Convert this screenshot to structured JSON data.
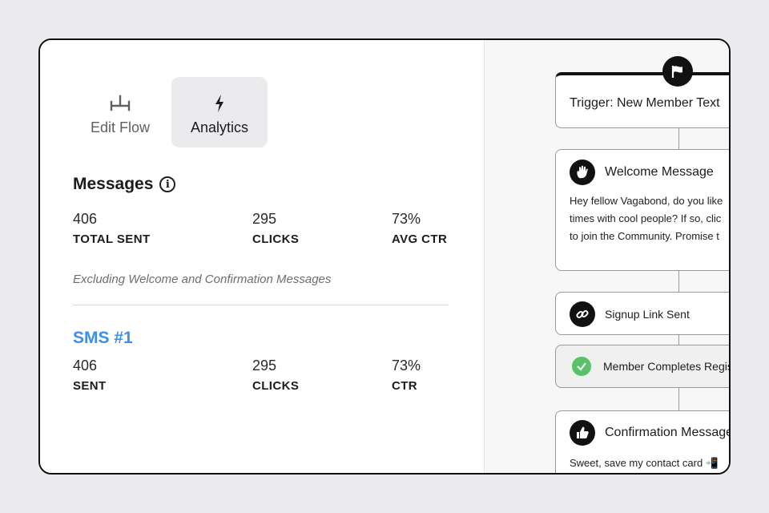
{
  "tabs": [
    {
      "label": "Edit Flow",
      "icon": "flow-icon"
    },
    {
      "label": "Analytics",
      "icon": "lightning-icon"
    }
  ],
  "messages": {
    "title": "Messages",
    "info_icon": "i",
    "stats": [
      {
        "value": "406",
        "label": "TOTAL SENT"
      },
      {
        "value": "295",
        "label": "CLICKS"
      },
      {
        "value": "73%",
        "label": "AVG CTR"
      }
    ],
    "note": "Excluding Welcome and Confirmation Messages"
  },
  "sms": {
    "title": "SMS #1",
    "stats": [
      {
        "value": "406",
        "label": "SENT"
      },
      {
        "value": "295",
        "label": "CLICKS"
      },
      {
        "value": "73%",
        "label": "CTR"
      }
    ]
  },
  "flow": {
    "trigger": "Trigger: New Member Text",
    "welcome": {
      "title": "Welcome Message",
      "lines": [
        "Hey fellow Vagabond, do you like",
        "times with cool people? If so, clic",
        "to join the Community. Promise t"
      ]
    },
    "signup": "Signup Link Sent",
    "registration": "Member Completes Regis",
    "confirmation": {
      "title": "Confirmation Message",
      "line": "Sweet, save my contact card 📲"
    }
  },
  "colors": {
    "accent": "#3d8fe6",
    "success": "#5cc06b"
  }
}
